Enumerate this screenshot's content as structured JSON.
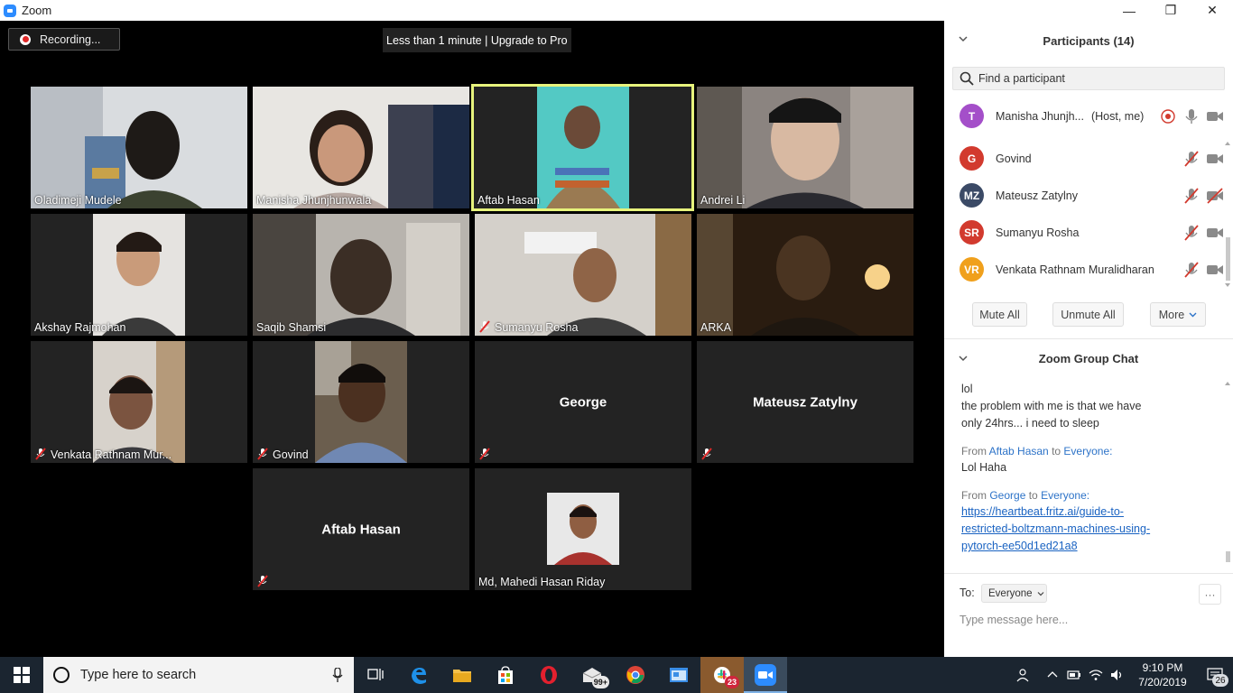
{
  "window": {
    "title": "Zoom",
    "minimize": "—",
    "maximize": "❐",
    "close": "✕"
  },
  "toolbar": {
    "recording_label": "Recording...",
    "timer_banner": "Less than 1 minute | Upgrade to Pro"
  },
  "tiles": [
    {
      "name": "Oladimeji Mudele",
      "muted": false,
      "video": true
    },
    {
      "name": "Manisha Jhunjhunwala",
      "muted": false,
      "video": true
    },
    {
      "name": "Aftab Hasan",
      "muted": false,
      "video": true,
      "active_speaker": true
    },
    {
      "name": "Andrei Li",
      "muted": false,
      "video": true
    },
    {
      "name": "Akshay Rajmohan",
      "muted": false,
      "video": true
    },
    {
      "name": "Saqib Shamsi",
      "muted": false,
      "video": true
    },
    {
      "name": "Sumanyu Rosha",
      "muted": true,
      "video": true
    },
    {
      "name": "ARKA",
      "muted": false,
      "video": true
    },
    {
      "name": "Venkata Rathnam Mur...",
      "muted": true,
      "video": true
    },
    {
      "name": "Govind",
      "muted": true,
      "video": true
    },
    {
      "name": "",
      "center_name": "George",
      "muted": true,
      "video": false
    },
    {
      "name": "",
      "center_name": "Mateusz Zatylny",
      "muted": true,
      "video": false
    },
    {
      "name": "",
      "center_name": "Aftab Hasan",
      "muted": true,
      "video": false
    },
    {
      "name": "Md, Mahedi Hasan Riday",
      "muted": false,
      "video": true
    }
  ],
  "participants": {
    "title": "Participants (14)",
    "search_placeholder": "Find a participant",
    "list": [
      {
        "initials": "T",
        "name": "Manisha Jhunjh...",
        "role": "(Host, me)",
        "color": "#a44fc9",
        "recording": true,
        "mic": "on",
        "video": "on"
      },
      {
        "initials": "G",
        "name": "Govind",
        "role": "",
        "color": "#d23a2e",
        "mic": "muted",
        "video": "on"
      },
      {
        "initials": "MZ",
        "name": "Mateusz Zatylny",
        "role": "",
        "color": "#3b4a66",
        "mic": "muted",
        "video": "off"
      },
      {
        "initials": "SR",
        "name": "Sumanyu Rosha",
        "role": "",
        "color": "#d23a2e",
        "mic": "muted",
        "video": "on"
      },
      {
        "initials": "VR",
        "name": "Venkata Rathnam Muralidharan",
        "role": "",
        "color": "#f0a01c",
        "mic": "muted",
        "video": "on"
      }
    ],
    "mute_all": "Mute All",
    "unmute_all": "Unmute All",
    "more": "More"
  },
  "chat": {
    "title": "Zoom Group Chat",
    "partial_line": "lol",
    "line2": "the problem with me is that we have",
    "line3": "only 24hrs... i need to sleep",
    "msg1": {
      "from_label": "From",
      "from": "Aftab Hasan",
      "to_label": "to",
      "to": "Everyone:",
      "text": "Lol Haha"
    },
    "msg2": {
      "from_label": "From",
      "from": "George",
      "to_label": "to",
      "to": "Everyone:",
      "link1": "https://heartbeat.fritz.ai/guide-to-",
      "link2": "restricted-boltzmann-machines-using-",
      "link3": "pytorch-ee50d1ed21a8"
    },
    "to_label": "To:",
    "to_value": "Everyone",
    "more": "···",
    "input_placeholder": "Type message here..."
  },
  "taskbar": {
    "search_placeholder": "Type here to search",
    "mail_badge": "99+",
    "slack_badge": "23",
    "time": "9:10 PM",
    "date": "7/20/2019",
    "notifications": "26"
  }
}
